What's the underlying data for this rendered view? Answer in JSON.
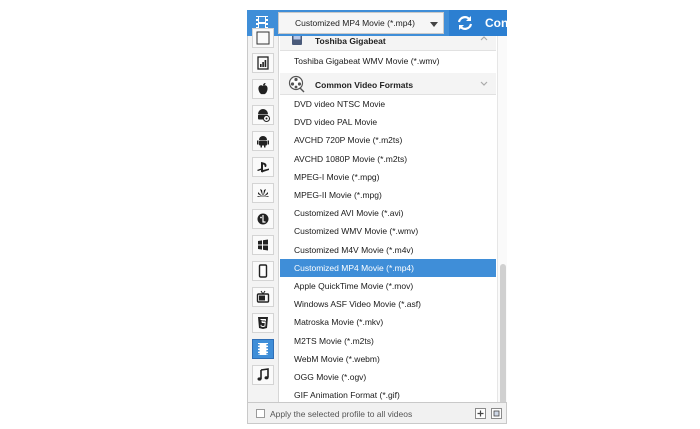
{
  "header": {
    "selected_profile": "Customized MP4 Movie (*.mp4)",
    "convert_label": "Conv"
  },
  "groups": [
    {
      "label": "Toshiba Gigabeat"
    },
    {
      "label": "Common Video Formats"
    }
  ],
  "toshiba_items": [
    "Toshiba Gigabeat WMV Movie (*.wmv)"
  ],
  "video_items": [
    "DVD video NTSC Movie",
    "DVD video PAL Movie",
    "AVCHD 720P Movie (*.m2ts)",
    "AVCHD 1080P Movie (*.m2ts)",
    "MPEG-I Movie (*.mpg)",
    "MPEG-II Movie (*.mpg)",
    "Customized AVI Movie (*.avi)",
    "Customized WMV Movie (*.wmv)",
    "Customized M4V Movie (*.m4v)",
    "Customized MP4 Movie (*.mp4)",
    "Apple QuickTime Movie (*.mov)",
    "Windows ASF Video Movie (*.asf)",
    "Matroska Movie (*.mkv)",
    "M2TS Movie (*.m2ts)",
    "WebM Movie (*.webm)",
    "OGG Movie (*.ogv)",
    "GIF Animation Format (*.gif)"
  ],
  "selected_index": 9,
  "sidebar_icons": [
    "film-icon",
    "chart-icon",
    "apple-icon",
    "android-settings-icon",
    "android-icon",
    "playstation-icon",
    "huawei-icon",
    "lg-icon",
    "windows-icon",
    "phone-icon",
    "tv-icon",
    "html5-icon",
    "video-icon",
    "music-icon"
  ],
  "active_sidebar": "video-icon",
  "footer": {
    "apply_label": "Apply the selected profile to all videos"
  },
  "colors": {
    "accent": "#3f8ed8",
    "convert": "#2c7fd1"
  }
}
